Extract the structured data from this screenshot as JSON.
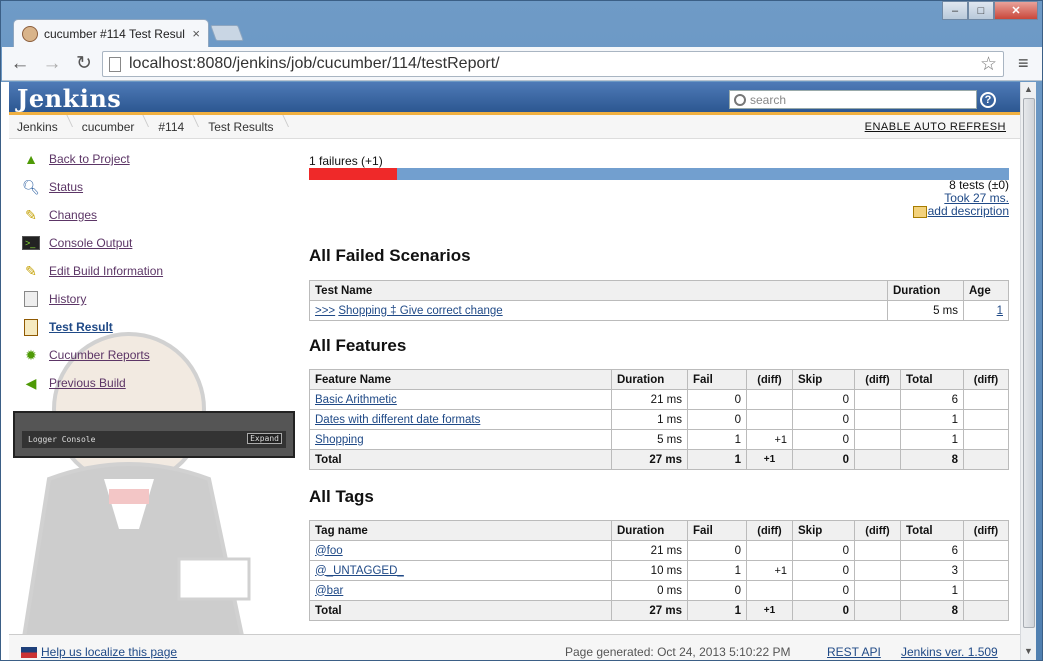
{
  "browser": {
    "tab_title": "cucumber #114 Test Resul",
    "url": "localhost:8080/jenkins/job/cucumber/114/testReport/",
    "window_controls": {
      "minimize": "–",
      "maximize": "□",
      "close": "✕"
    }
  },
  "header": {
    "logo": "Jenkins",
    "search_placeholder": "search",
    "help": "?"
  },
  "breadcrumbs": [
    "Jenkins",
    "cucumber",
    "#114",
    "Test Results"
  ],
  "auto_refresh": "ENABLE AUTO REFRESH",
  "sidebar": {
    "items": [
      {
        "label": "Back to Project",
        "icon": "up-arrow-icon"
      },
      {
        "label": "Status",
        "icon": "magnifier-icon"
      },
      {
        "label": "Changes",
        "icon": "notepad-icon"
      },
      {
        "label": "Console Output",
        "icon": "terminal-icon"
      },
      {
        "label": "Edit Build Information",
        "icon": "notepad-icon"
      },
      {
        "label": "History",
        "icon": "history-icon"
      },
      {
        "label": "Test Result",
        "icon": "clipboard-icon",
        "active": true
      },
      {
        "label": "Cucumber Reports",
        "icon": "cucumber-icon"
      },
      {
        "label": "Previous Build",
        "icon": "left-arrow-icon"
      }
    ],
    "logger": {
      "title": "Logger Console",
      "expand": "Expand"
    }
  },
  "summary": {
    "failures": "1 failures (+1)",
    "fail_fraction": 0.125,
    "tests": "8 tests (±0)",
    "took": "Took 27 ms.",
    "add_description": "add description"
  },
  "failed": {
    "heading": "All Failed Scenarios",
    "headers": [
      "Test Name",
      "Duration",
      "Age"
    ],
    "rows": [
      {
        "prefix": ">>>",
        "name": "Shopping ‡ Give correct change",
        "duration": "5 ms",
        "age": "1"
      }
    ]
  },
  "features": {
    "heading": "All Features",
    "headers": [
      "Feature Name",
      "Duration",
      "Fail",
      "(diff)",
      "Skip",
      "(diff)",
      "Total",
      "(diff)"
    ],
    "rows": [
      {
        "name": "Basic Arithmetic",
        "duration": "21 ms",
        "fail": "0",
        "fail_diff": "",
        "skip": "0",
        "skip_diff": "",
        "total": "6",
        "total_diff": ""
      },
      {
        "name": "Dates with different date formats",
        "duration": "1 ms",
        "fail": "0",
        "fail_diff": "",
        "skip": "0",
        "skip_diff": "",
        "total": "1",
        "total_diff": ""
      },
      {
        "name": "Shopping",
        "duration": "5 ms",
        "fail": "1",
        "fail_diff": "+1",
        "skip": "0",
        "skip_diff": "",
        "total": "1",
        "total_diff": ""
      }
    ],
    "total": {
      "label": "Total",
      "duration": "27 ms",
      "fail": "1",
      "fail_diff": "+1",
      "skip": "0",
      "total": "8"
    }
  },
  "tags": {
    "heading": "All Tags",
    "headers": [
      "Tag name",
      "Duration",
      "Fail",
      "(diff)",
      "Skip",
      "(diff)",
      "Total",
      "(diff)"
    ],
    "rows": [
      {
        "name": "@foo",
        "duration": "21 ms",
        "fail": "0",
        "fail_diff": "",
        "skip": "0",
        "skip_diff": "",
        "total": "6",
        "total_diff": ""
      },
      {
        "name": "@_UNTAGGED_",
        "duration": "10 ms",
        "fail": "1",
        "fail_diff": "+1",
        "skip": "0",
        "skip_diff": "",
        "total": "3",
        "total_diff": ""
      },
      {
        "name": "@bar",
        "duration": "0 ms",
        "fail": "0",
        "fail_diff": "",
        "skip": "0",
        "skip_diff": "",
        "total": "1",
        "total_diff": ""
      }
    ],
    "total": {
      "label": "Total",
      "duration": "27 ms",
      "fail": "1",
      "fail_diff": "+1",
      "skip": "0",
      "total": "8"
    }
  },
  "footer": {
    "localize": "Help us localize this page",
    "generated": "Page generated: Oct 24, 2013 5:10:22 PM",
    "rest_api": "REST API",
    "version": "Jenkins ver. 1.509"
  }
}
